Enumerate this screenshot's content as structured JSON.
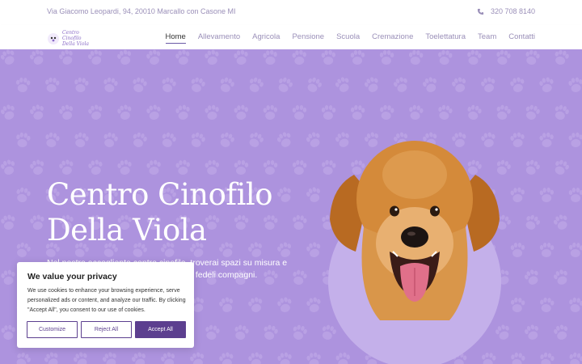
{
  "topbar": {
    "address": "Via Giacomo Leopardi, 94, 20010 Marcallo con Casone MI",
    "phone": "320 708 8140",
    "phone_icon": "phone-icon"
  },
  "logo": {
    "text": "Centro Cinofilo Della Viola"
  },
  "nav": {
    "items": [
      "Home",
      "Allevamento",
      "Agricola",
      "Pensione",
      "Scuola",
      "Cremazione",
      "Toelettatura",
      "Team",
      "Contatti"
    ],
    "active": "Home"
  },
  "hero": {
    "title_line1": "Centro Cinofilo",
    "title_line2": "Della Viola",
    "text": "Nel nostro accogliente centro cinofilo, troverai spazi su misura e servizi pensati per il benessere dei tuoi fedeli compagni."
  },
  "cookie": {
    "title": "We value your privacy",
    "body": "We use cookies to enhance your browsing experience, serve personalized ads or content, and analyze our traffic. By clicking \"Accept All\", you consent to our use of cookies.",
    "customize": "Customize",
    "reject": "Reject All",
    "accept": "Accept All"
  },
  "colors": {
    "hero_bg": "#ad93de",
    "accent": "#5c3f8f",
    "nav_text": "#9a8fb8"
  }
}
